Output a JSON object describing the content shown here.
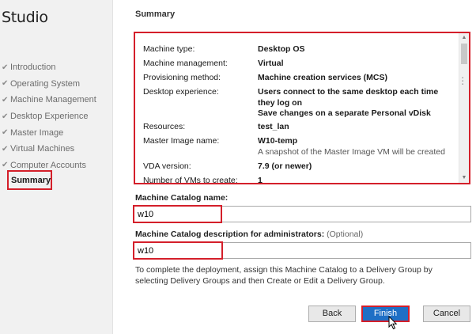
{
  "app": {
    "title": "Studio"
  },
  "sidebar": {
    "steps": [
      {
        "label": "Introduction",
        "done": true
      },
      {
        "label": "Operating System",
        "done": true
      },
      {
        "label": "Machine Management",
        "done": true
      },
      {
        "label": "Desktop Experience",
        "done": true
      },
      {
        "label": "Master Image",
        "done": true
      },
      {
        "label": "Virtual Machines",
        "done": true
      },
      {
        "label": "Computer Accounts",
        "done": true
      }
    ],
    "current_step": "Summary",
    "check_glyph": "✔"
  },
  "main": {
    "title": "Summary",
    "summary": [
      {
        "label": "Machine type:",
        "value": "Desktop OS"
      },
      {
        "label": "Machine management:",
        "value": "Virtual"
      },
      {
        "label": "Provisioning method:",
        "value": "Machine creation services (MCS)"
      },
      {
        "label": "Desktop experience:",
        "value": "Users connect to the same desktop each time they log on",
        "value2": "Save changes on a separate Personal vDisk"
      },
      {
        "label": "Resources:",
        "value": "test_lan"
      },
      {
        "label": "Master Image name:",
        "value": "W10-temp",
        "note": "A snapshot of the Master Image VM will be created"
      },
      {
        "label": "VDA version:",
        "value": "7.9 (or newer)"
      },
      {
        "label": "Number of VMs to create:",
        "value": "1"
      }
    ],
    "catalog_name": {
      "label": "Machine Catalog name:",
      "value": "w10"
    },
    "catalog_description": {
      "label": "Machine Catalog description for administrators:",
      "optional": "(Optional)",
      "value": "w10"
    },
    "info": "To complete the deployment, assign this Machine Catalog to a Delivery Group by selecting Delivery Groups and then Create or Edit a Delivery Group."
  },
  "buttons": {
    "back": "Back",
    "finish": "Finish",
    "cancel": "Cancel"
  },
  "colors": {
    "highlight": "#d41f2a",
    "primary": "#1f6fc5"
  }
}
